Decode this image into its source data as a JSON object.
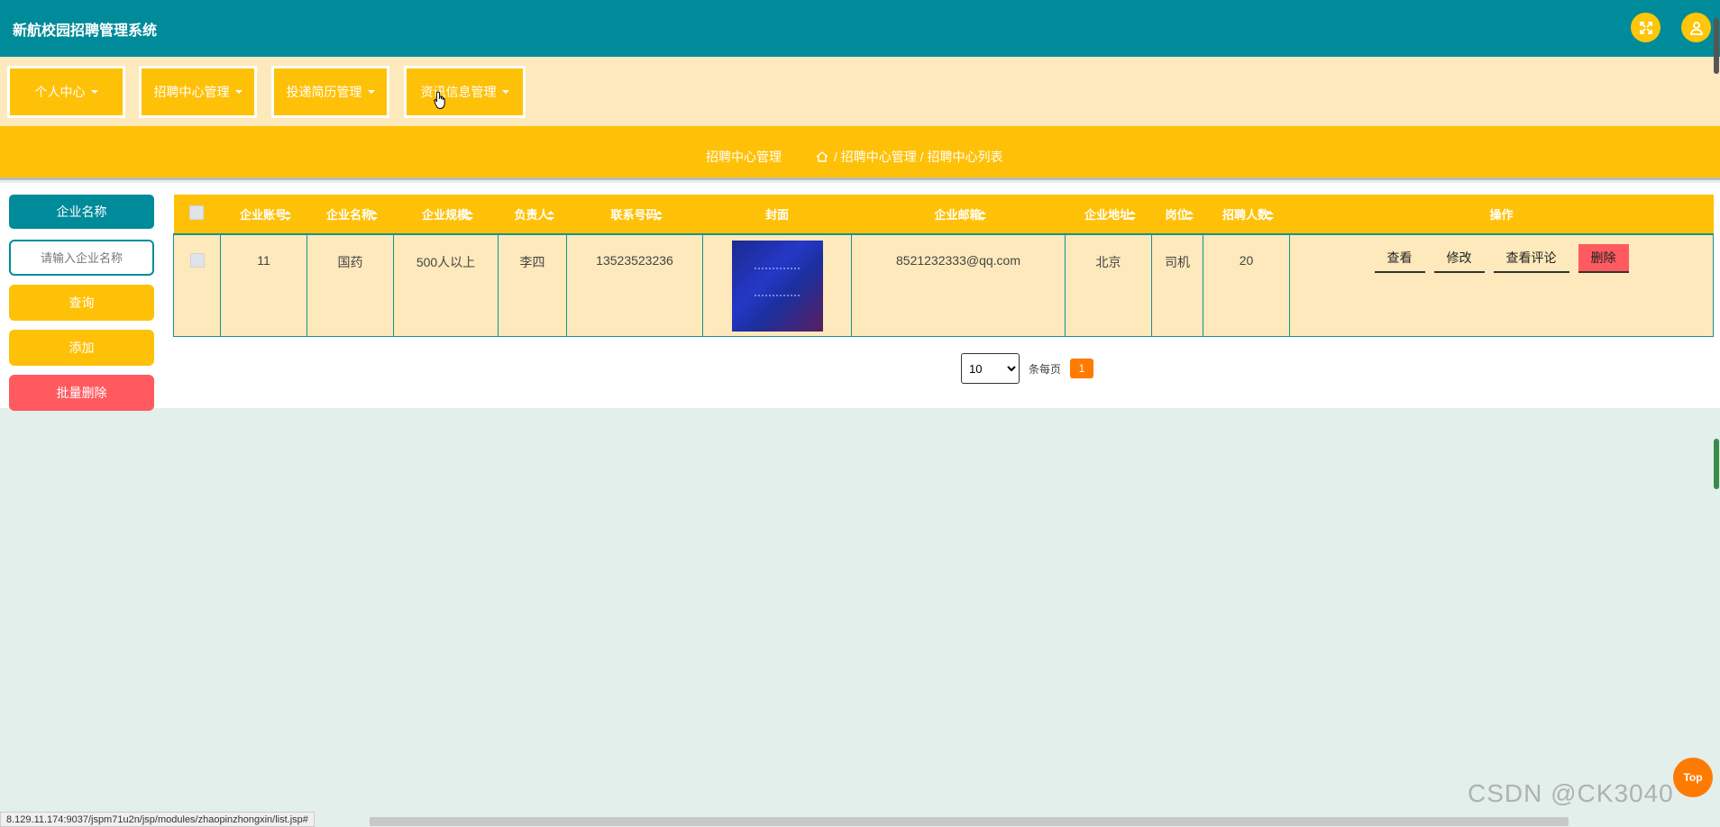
{
  "app": {
    "title": "新航校园招聘管理系统"
  },
  "header_buttons": {
    "fullscreen_icon": "expand-icon",
    "user_icon": "user-icon",
    "accent": "#ffc60a"
  },
  "menu": [
    {
      "label": "个人中心"
    },
    {
      "label": "招聘中心管理"
    },
    {
      "label": "投递简历管理"
    },
    {
      "label": "资讯信息管理"
    }
  ],
  "breadcrumb": {
    "section": "招聘中心管理",
    "path": "/ 招聘中心管理 / 招聘中心列表"
  },
  "sidebar": {
    "label": "企业名称",
    "search_placeholder": "请输入企业名称",
    "query_button": "查询",
    "add_button": "添加",
    "batch_delete_button": "批量删除"
  },
  "table": {
    "columns": [
      "企业账号",
      "企业名称",
      "企业规模",
      "负责人",
      "联系号码",
      "封面",
      "企业邮箱",
      "企业地址",
      "岗位",
      "招聘人数",
      "操作"
    ],
    "rows": [
      {
        "account": "11",
        "name": "国药",
        "scale": "500人以上",
        "contact": "李四",
        "phone": "13523523236",
        "email": "8521232333@qq.com",
        "address": "北京",
        "position": "司机",
        "count": "20",
        "actions": {
          "view": "查看",
          "edit": "修改",
          "comments": "查看评论",
          "delete": "删除"
        }
      }
    ]
  },
  "pager": {
    "page_size": "10",
    "per_page_label": "条每页",
    "current_page": "1"
  },
  "top_button": "Top",
  "status_url": "8.129.11.174:9037/jspm71u2n/jsp/modules/zhaopinzhongxin/list.jsp#",
  "watermark": "CSDN @CK3040",
  "colors": {
    "teal": "#008b9a",
    "yellow": "#ffc107",
    "cream": "#fde9bb",
    "danger": "#ff5a5f",
    "orange": "#ff7a00"
  }
}
